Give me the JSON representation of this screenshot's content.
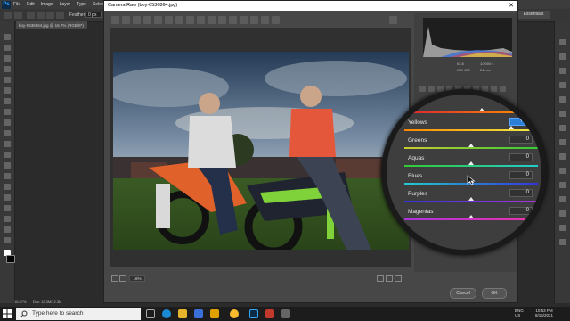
{
  "ps": {
    "logo": "Ps",
    "menu": [
      "File",
      "Edit",
      "Image",
      "Layer",
      "Type",
      "Select"
    ],
    "feather_label": "Feather:",
    "feather_value": "0 px",
    "doc_tab": "boy-6536864.jpg @ 16.7% (RGB/8*)",
    "workspace": "Essentials",
    "status_zoom": "16.67%",
    "status_doc": "Doc: 12.3M/12.3M"
  },
  "camera_raw": {
    "title": "Camera Raw (boy-6536864.jpg)",
    "close": "✕",
    "camera_info": {
      "fstop": "f/2.8",
      "shutter": "1/2000 s",
      "iso": "ISO 100",
      "focal": "24 mm"
    },
    "zoom": "16%",
    "cancel_label": "Cancel",
    "ok_label": "OK",
    "hsl": [
      {
        "name": "Oranges",
        "label": "ges",
        "value": "-1",
        "pos": 0.58
      },
      {
        "name": "Yellows",
        "label": "Yellows",
        "value": "+63",
        "pos": 0.8
      },
      {
        "name": "Greens",
        "label": "Greens",
        "value": "0",
        "pos": 0.5
      },
      {
        "name": "Aquas",
        "label": "Aquas",
        "value": "0",
        "pos": 0.5
      },
      {
        "name": "Blues",
        "label": "Blues",
        "value": "0",
        "pos": 0.5
      },
      {
        "name": "Purples",
        "label": "Purples",
        "value": "0",
        "pos": 0.5
      },
      {
        "name": "Magentas",
        "label": "Magentas",
        "value": "0",
        "pos": 0.5
      }
    ]
  },
  "taskbar": {
    "search_placeholder": "Type here to search",
    "lang": "ENG",
    "region": "US",
    "time": "10:53 PM",
    "date": "8/15/2021"
  },
  "colors": {
    "active_value": "#2b7fd6",
    "dialog_bg": "#474747",
    "ps_bg": "#2b2b2b"
  }
}
